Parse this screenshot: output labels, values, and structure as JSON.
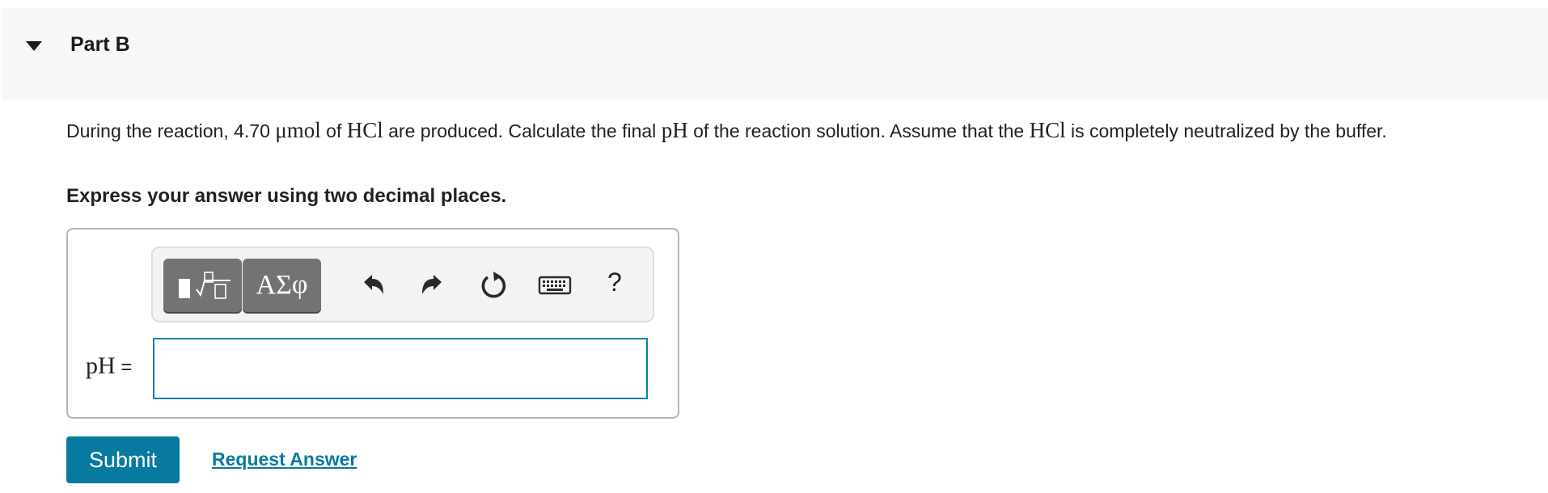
{
  "part": {
    "title": "Part B"
  },
  "question": {
    "text_1": "During the reaction, 4.70 ",
    "unit": "μmol",
    "text_2": " of ",
    "hcl": "HCl",
    "text_3": " are produced. Calculate the final ",
    "ph": "pH",
    "text_4": " of the reaction solution. Assume that the ",
    "hcl_2": "HCl",
    "text_5": " is completely neutralized by the buffer."
  },
  "instruction": "Express your answer using two decimal places.",
  "toolbar": {
    "greek_label": "ΑΣφ",
    "help_label": "?",
    "icons": [
      "templates-icon",
      "undo-icon",
      "redo-icon",
      "reset-icon",
      "keyboard-icon",
      "help-icon"
    ]
  },
  "answer": {
    "label": "pH",
    "equals": " =",
    "value": "",
    "placeholder": ""
  },
  "actions": {
    "submit_label": "Submit",
    "request_label": "Request Answer"
  },
  "colors": {
    "accent": "#087aa0",
    "input_border": "#0e7fa8",
    "toolbar_button": "#737373",
    "header_bg": "#f7f7f7"
  }
}
